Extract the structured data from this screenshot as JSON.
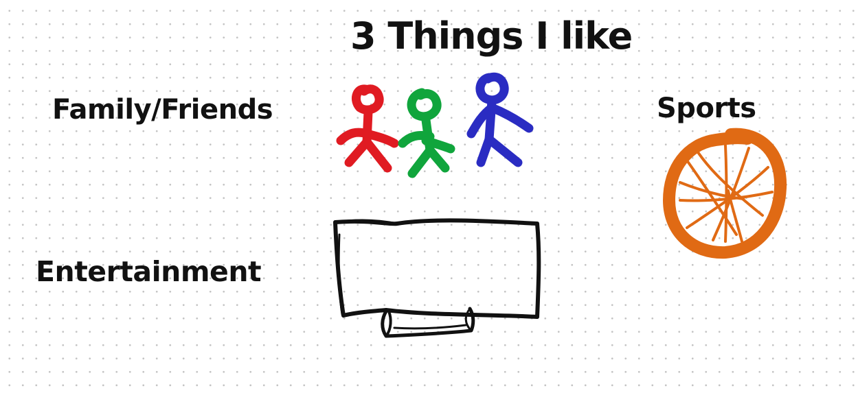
{
  "board": {
    "title": "3 Things I like",
    "items": [
      {
        "label": "Family/Friends"
      },
      {
        "label": "Sports"
      },
      {
        "label": "Entertainment"
      }
    ]
  },
  "drawings": {
    "figures": [
      "stick-figure-red",
      "stick-figure-green",
      "stick-figure-blue"
    ],
    "ball": "basketball-drawing",
    "screen": "tv-drawing"
  },
  "colors": {
    "background": "#ffffff",
    "dot_grid": "#c4c4c4",
    "text": "#111111",
    "figure_red": "#e01b22",
    "figure_green": "#10a53c",
    "figure_blue": "#2a2cc2",
    "ball": "#e06a14",
    "tv": "#111111"
  }
}
